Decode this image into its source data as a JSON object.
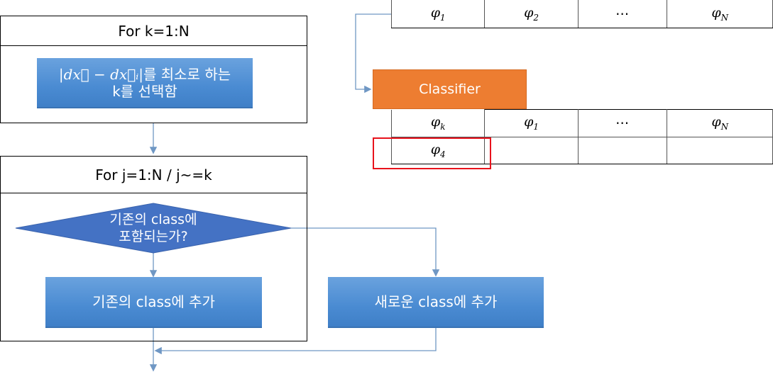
{
  "outer_loop": {
    "header": "For k=1:N",
    "select_box": {
      "formula": "|dx⃗ − dx⃗ᵢ|",
      "line1_suffix": "를 최소로 하는",
      "line2": "k를 선택함"
    }
  },
  "inner_loop": {
    "header": "For j=1:N / j~=k",
    "decision": {
      "line1": "기존의 class에",
      "line2": "포함되는가?"
    },
    "existing_class_box": "기존의 class에 추가"
  },
  "new_class_box": "새로운 class에 추가",
  "classifier": {
    "label": "Classifier",
    "color": "#ed7d31"
  },
  "input_table": {
    "cells": [
      {
        "sym": "φ",
        "sub": "1"
      },
      {
        "sym": "φ",
        "sub": "2"
      },
      {
        "sym": "⋯",
        "sub": ""
      },
      {
        "sym": "φ",
        "sub": "N"
      }
    ]
  },
  "output_table": {
    "row1": [
      {
        "sym": "φ",
        "sub": "k"
      },
      {
        "sym": "φ",
        "sub": "1"
      },
      {
        "sym": "⋯",
        "sub": ""
      },
      {
        "sym": "φ",
        "sub": "N"
      }
    ],
    "row2": [
      {
        "sym": "φ",
        "sub": "4"
      },
      {
        "sym": "",
        "sub": ""
      },
      {
        "sym": "",
        "sub": ""
      },
      {
        "sym": "",
        "sub": ""
      }
    ],
    "highlight_color": "#e8121c"
  },
  "colors": {
    "process_blue": "#4a8bd2",
    "decision_blue": "#4472c4",
    "connector": "#6f97c4"
  }
}
